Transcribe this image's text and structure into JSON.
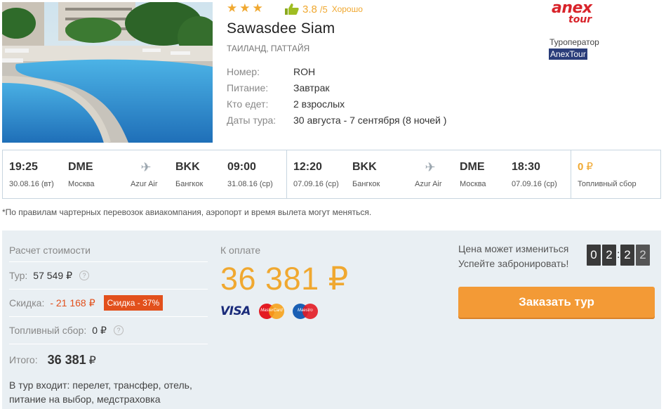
{
  "hotel": {
    "stars": 3,
    "rating_score": "3.8",
    "rating_max": "/5",
    "rating_word": "Хорошо",
    "name": "Sawasdee Siam",
    "location": "ТАИЛАНД, ПАТТАЙЯ",
    "details": [
      {
        "label": "Номер:",
        "value": "ROH"
      },
      {
        "label": "Питание:",
        "value": "Завтрак"
      },
      {
        "label": "Кто едет:",
        "value": "2 взрослых"
      },
      {
        "label": "Даты тура:",
        "value": "30 августа - 7 сентября (8 ночей )"
      }
    ]
  },
  "operator": {
    "logo_line1": "anex",
    "logo_line2": "tour",
    "label": "Туроператор",
    "name": "AnexTour"
  },
  "flights": {
    "outbound": {
      "dep_time": "19:25",
      "dep_date": "30.08.16 (вт)",
      "dep_code": "DME",
      "dep_city": "Москва",
      "airline": "Azur Air",
      "arr_code": "BKK",
      "arr_city": "Бангкок",
      "arr_time": "09:00",
      "arr_date": "31.08.16 (ср)"
    },
    "return": {
      "dep_time": "12:20",
      "dep_date": "07.09.16 (ср)",
      "dep_code": "BKK",
      "dep_city": "Бангкок",
      "airline": "Azur Air",
      "arr_code": "DME",
      "arr_city": "Москва",
      "arr_time": "18:30",
      "arr_date": "07.09.16 (ср)"
    },
    "fuel_price": "0",
    "fuel_currency": "₽",
    "fuel_label": "Топливный сбор"
  },
  "note": "*По правилам чартерных перевозок авиакомпания, аэропорт и время вылета могут меняться.",
  "calc": {
    "title": "Расчет стоимости",
    "tour_label": "Тур:",
    "tour_value": "57 549",
    "discount_label": "Скидка:",
    "discount_value": "- 21 168",
    "discount_badge": "Скидка - 37%",
    "fuel_label": "Топливный сбор:",
    "fuel_value": "0",
    "total_label": "Итого:",
    "total_value": "36 381",
    "currency": "₽",
    "help_icon": "?",
    "includes": "В тур входит: перелет, трансфер, отель, питание на выбор, медстраховка"
  },
  "payment": {
    "label": "К оплате",
    "amount": "36 381",
    "currency": "₽",
    "cards": {
      "visa": "VISA",
      "mastercard": "MasterCard",
      "maestro": "Maestro"
    }
  },
  "timer": {
    "line1": "Цена может измениться",
    "line2": "Успейте забронировать!",
    "digits": [
      "0",
      "2",
      "2",
      "2"
    ]
  },
  "book_button": "Заказать тур",
  "colors": {
    "accent": "#f39a36",
    "price": "#f0a830",
    "discount": "#e2501c",
    "operator_bg": "#2a3d7a"
  },
  "icons": {
    "star": "star-icon",
    "thumb": "thumbs-up-icon",
    "plane": "airplane-icon",
    "help": "help-icon"
  }
}
